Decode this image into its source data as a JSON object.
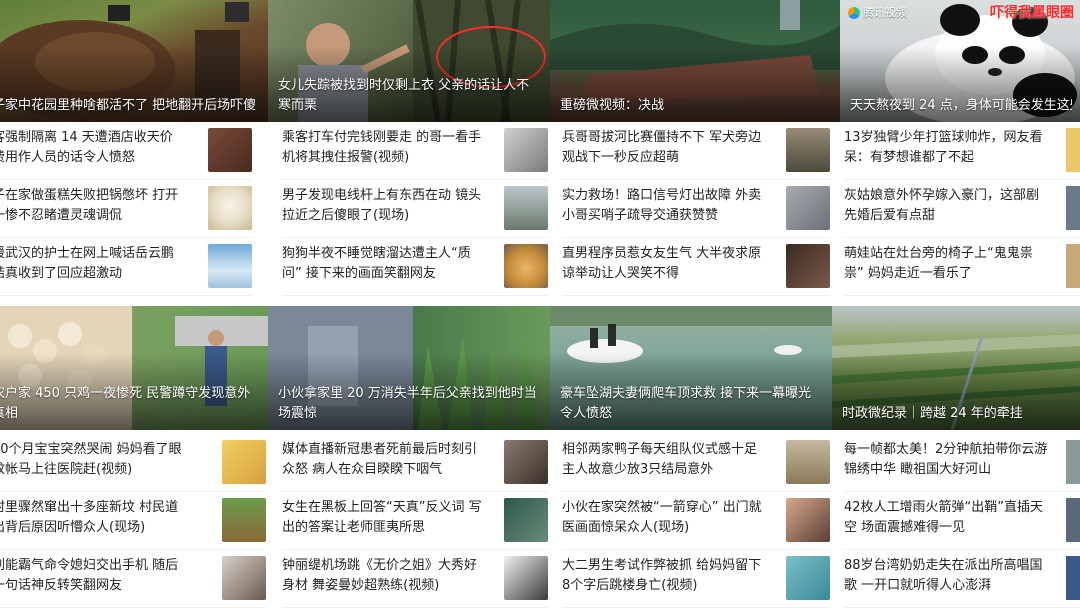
{
  "colors": {
    "caption_text": "#ffffff",
    "title_text": "#222222",
    "stamp_red": "#ff2a2a"
  },
  "watermark": {
    "brand": "腾讯视频",
    "stamp": "吓得我黑眼圈",
    "icon": "tencent-video-logo-icon"
  },
  "hero_top": [
    {
      "caption": "子家中花园里种啥都活不了 把地翻开后场吓傻"
    },
    {
      "caption": "女儿失踪被找到时仅剩上衣 父亲的话让人不寒而栗"
    },
    {
      "caption": "重磅微视频：决战"
    },
    {
      "caption": "天天熬夜到 24 点，身体可能会发生这些改变"
    }
  ],
  "hero_bottom": [
    {
      "caption": "农户家 450 只鸡一夜惨死 民警蹲守发现意外真相"
    },
    {
      "caption": "小伙拿家里 20 万消失半年后父亲找到他时当场震惊"
    },
    {
      "caption": "豪车坠湖夫妻俩爬车顶求救 接下来一幕曝光令人愤怒"
    },
    {
      "caption": "时政微纪录｜跨越 24 年的牵挂"
    }
  ],
  "news_top": [
    [
      {
        "title": "客强制隔离 14 天遭酒店收天价费用作人员的话令人愤怒",
        "thumb": "hotel-door-thumbnail"
      },
      {
        "title": "子在家做蛋糕失败把锅憋坏 打开一惨不忍睹遭灵魂调侃",
        "thumb": "rice-cooker-thumbnail"
      },
      {
        "title": "援武汉的护士在网上喊话岳云鹏 结真收到了回应超激动",
        "thumb": "nurse-thumbnail"
      }
    ],
    [
      {
        "title": "乘客打车付完钱刚要走 的哥一看手机将其拽住报警(视频)",
        "thumb": "taxi-thumbnail"
      },
      {
        "title": "男子发现电线杆上有东西在动 镜头拉近之后傻眼了(现场)",
        "thumb": "pole-thumbnail"
      },
      {
        "title": "狗狗半夜不睡觉瞎溜达遭主人“质问” 接下来的画面笑翻网友",
        "thumb": "dog-thumbnail"
      }
    ],
    [
      {
        "title": "兵哥哥拔河比赛僵持不下 军犬旁边观战下一秒反应超萌",
        "thumb": "soldiers-thumbnail"
      },
      {
        "title": "实力救场！路口信号灯出故障 外卖小哥买哨子疏导交通获赞赞",
        "thumb": "crossroad-thumbnail"
      },
      {
        "title": "直男程序员惹女友生气 大半夜求原谅举动让人哭笑不得",
        "thumb": "street-night-thumbnail"
      }
    ],
    [
      {
        "title": "13岁独臂少年打篮球帅炸，网友看呆：有梦想谁都了不起",
        "thumb": "basketball-thumbnail"
      },
      {
        "title": "灰姑娘意外怀孕嫁入豪门，这部剧先婚后爱有点甜",
        "thumb": "drama-thumbnail"
      },
      {
        "title": "萌娃站在灶台旁的椅子上“鬼鬼祟祟” 妈妈走近一看乐了",
        "thumb": "kitchen-thumbnail"
      }
    ]
  ],
  "news_bottom": [
    [
      {
        "title": "10个月宝宝突然哭闹 妈妈看了眼蚊帐马上往医院赶(视频)",
        "thumb": "baby-bed-thumbnail"
      },
      {
        "title": "村里骤然窜出十多座新坟 村民道出背后原因听懵众人(现场)",
        "thumb": "graves-thumbnail"
      },
      {
        "title": "刘能霸气命令媳妇交出手机 随后一句话神反转笑翻网友",
        "thumb": "actor-thumbnail"
      }
    ],
    [
      {
        "title": "媒体直播新冠患者死前最后时刻引众怒 病人在众目睽睽下咽气",
        "thumb": "hospital-thumbnail"
      },
      {
        "title": "女生在黑板上回答“天真”反义词 写出的答案让老师匪夷所思",
        "thumb": "classroom-thumbnail"
      },
      {
        "title": "钟丽缇机场跳《无价之姐》大秀好身材 舞姿曼妙超熟练(视频)",
        "thumb": "dancer-thumbnail"
      }
    ],
    [
      {
        "title": "相邻两家鸭子每天组队仪式感十足 主人故意少放3只结局意外",
        "thumb": "ducks-thumbnail"
      },
      {
        "title": "小伙在家突然被“一箭穿心” 出门就医画面惊呆众人(现场)",
        "thumb": "patient-thumbnail"
      },
      {
        "title": "大二男生考试作弊被抓 给妈妈留下8个字后跳楼身亡(视频)",
        "thumb": "student-thumbnail"
      }
    ],
    [
      {
        "title": "每一帧都太美！2分钟航拍带你云游锦绣中华 瞰祖国大好河山",
        "thumb": "landscape-thumbnail"
      },
      {
        "title": "42枚人工增雨火箭弹“出鞘”直插天空 场面震撼难得一见",
        "thumb": "rocket-thumbnail"
      },
      {
        "title": "88岁台湾奶奶走失在派出所高唱国歌 一开口就听得人心澎湃",
        "thumb": "grandma-thumbnail"
      }
    ]
  ]
}
